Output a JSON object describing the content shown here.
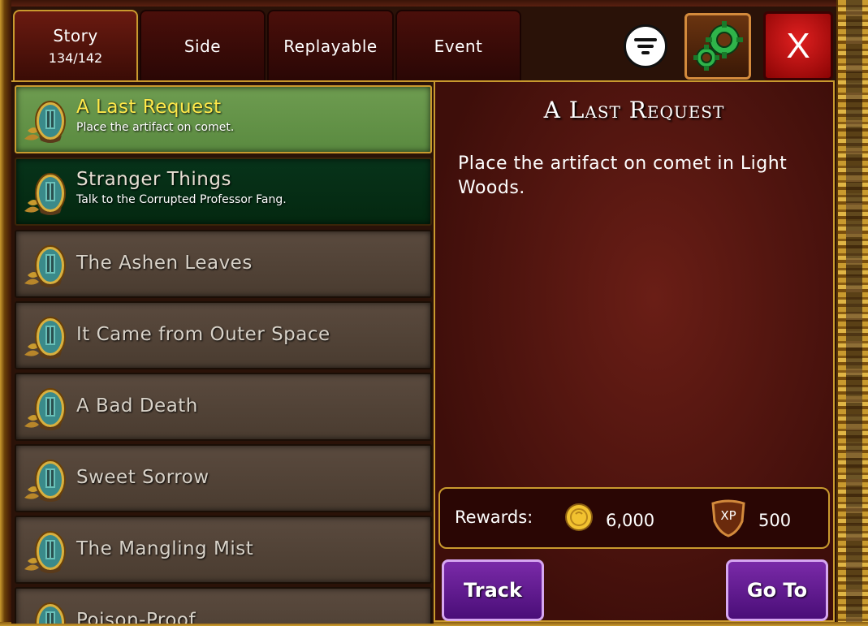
{
  "tabs": [
    {
      "label": "Story",
      "count": "134/142",
      "active": true
    },
    {
      "label": "Side"
    },
    {
      "label": "Replayable"
    },
    {
      "label": "Event"
    }
  ],
  "controls": {
    "filter_icon": "filter-icon",
    "settings_icon": "gears-icon",
    "close_label": "X"
  },
  "quests": [
    {
      "title": "A Last Request",
      "description": "Place the artifact on comet.",
      "state": "selected"
    },
    {
      "title": "Stranger Things",
      "description": "Talk to the Corrupted Professor Fang.",
      "state": "tracked"
    },
    {
      "title": "The Ashen Leaves",
      "state": "normal"
    },
    {
      "title": "It Came from Outer Space",
      "state": "normal"
    },
    {
      "title": "A Bad Death",
      "state": "normal"
    },
    {
      "title": "Sweet Sorrow",
      "state": "normal"
    },
    {
      "title": "The Mangling Mist",
      "state": "normal"
    },
    {
      "title": "Poison-Proof",
      "state": "normal"
    }
  ],
  "detail": {
    "title": "A Last Request",
    "description": "Place the artifact on comet in Light Woods.",
    "rewards_label": "Rewards:",
    "gold": "6,000",
    "xp_badge": "XP",
    "xp": "500",
    "track_label": "Track",
    "goto_label": "Go To"
  },
  "colors": {
    "selected_row": "#6e9c50",
    "tracked_row": "#07331a",
    "selected_title": "#ffe94a",
    "action_button": "#5a1a90",
    "gold_border": "#c99a2e"
  }
}
